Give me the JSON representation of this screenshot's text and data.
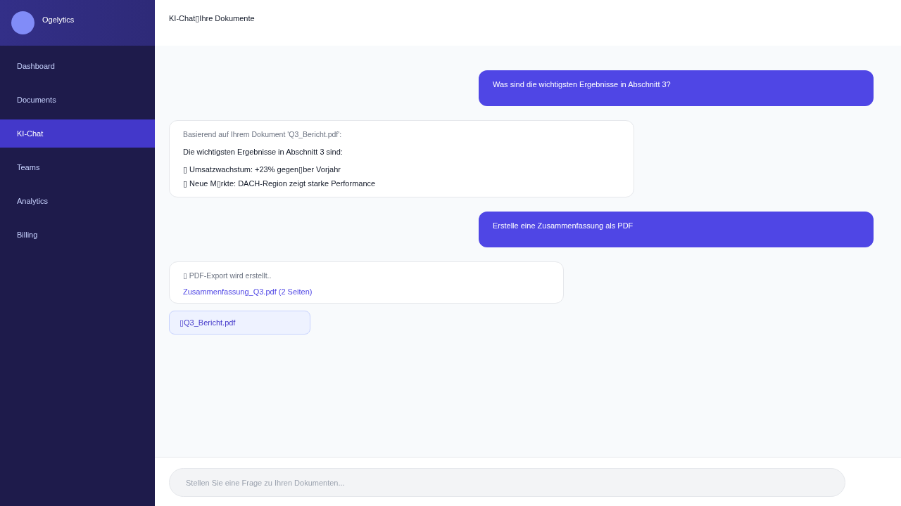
{
  "sidebar": {
    "brand": "Ogelytics",
    "items": [
      {
        "label": "Dashboard",
        "selected": false
      },
      {
        "label": "Documents",
        "selected": false
      },
      {
        "label": "KI-Chat",
        "selected": true
      },
      {
        "label": "Teams",
        "selected": false
      },
      {
        "label": "Analytics",
        "selected": false
      },
      {
        "label": "Billing",
        "selected": false
      }
    ]
  },
  "header": {
    "title": "KI-Chat▯Ihre Dokumente"
  },
  "messages": [
    {
      "kind": "user",
      "text": "Was sind die wichtigsten Ergebnisse in Abschnitt 3?"
    },
    {
      "kind": "answer",
      "intro": "Basierend auf Ihrem Dokument 'Q3_Bericht.pdf':",
      "text": "Die wichtigsten Ergebnisse in Abschnitt 3 sind:",
      "bullets": [
        "▯ Umsatzwachstum: +23% gegen▯ber Vorjahr",
        "▯ Neue M▯rkte: DACH-Region zeigt starke Performance"
      ]
    },
    {
      "kind": "user",
      "text": "Erstelle eine Zusammenfassung als PDF"
    },
    {
      "kind": "export",
      "status": "▯ PDF-Export wird erstellt..",
      "link": "Zusammenfassung_Q3.pdf (2 Seiten)"
    },
    {
      "kind": "file",
      "name": "▯Q3_Bericht.pdf"
    }
  ],
  "composer": {
    "placeholder": "Stellen Sie eine Frage zu Ihren Dokumenten..."
  }
}
